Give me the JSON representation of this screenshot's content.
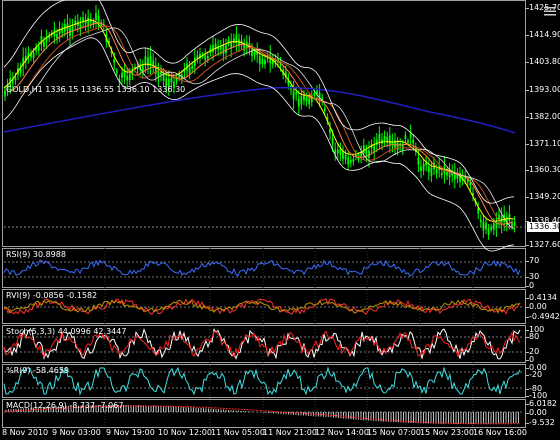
{
  "main_label": "GOLD,H1  1336.15 1336.55 1336.10 1336.30",
  "current_price": "1336.30",
  "price_ticks": [
    "1425.70",
    "1414.90",
    "1403.80",
    "1393.00",
    "1382.00",
    "1371.10",
    "1360.30",
    "1349.20",
    "1338.40",
    "1327.60"
  ],
  "rsi": {
    "label": "RSI(9) 30.8988",
    "ticks": [
      "70",
      "30",
      "0"
    ]
  },
  "rvi": {
    "label": "RVI(9) -0.0856 -0.1582",
    "ticks": [
      "0.4134",
      "0.00",
      "-0.4942"
    ]
  },
  "stoch": {
    "label": "Stoch(5,3,3) 44.0996 42.3447",
    "ticks": [
      "100",
      "80",
      "20",
      "0"
    ]
  },
  "wpr": {
    "label": "%R(9) -58.4659",
    "ticks": [
      "0.00",
      "-20",
      "-80",
      "-100"
    ]
  },
  "macd": {
    "label": "MACD(12,26,9) -8.737 -7.067",
    "ticks": [
      "6.0182",
      "0.00",
      "-9.532"
    ]
  },
  "time_labels": [
    "8 Nov 2010",
    "9 Nov 03:00",
    "9 Nov 19:00",
    "10 Nov 12:00",
    "11 Nov 05:00",
    "11 Nov 21:00",
    "12 Nov 14:00",
    "15 Nov 07:00",
    "15 Nov 23:00",
    "16 Nov 16:00"
  ],
  "colors": {
    "candle": "#00ff00",
    "bollinger": "#ffffff",
    "ma_blue": "#2020c0",
    "ma_fast": "#ffff00",
    "ma_mid": "#ff8040",
    "ma_slow": "#c05020",
    "rsi": "#3c6cff",
    "rvi_main": "#ff3030",
    "rvi_signal": "#c09000",
    "stoch_main": "#ffffff",
    "stoch_signal": "#ff2020",
    "wpr": "#40e0e0",
    "macd_hist": "#c0c0c0",
    "macd_signal": "#ff2020"
  },
  "icons": {
    "menu": "menu-icon"
  }
}
